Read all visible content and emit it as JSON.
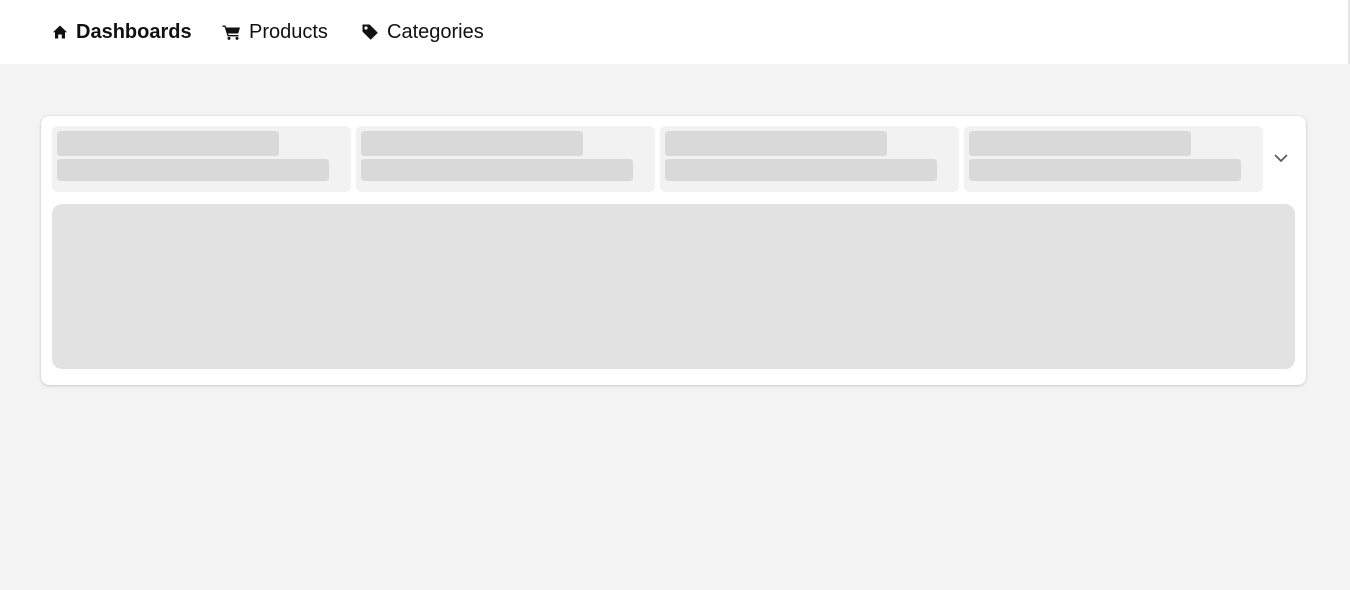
{
  "nav": {
    "items": [
      {
        "label": "Dashboards",
        "icon": "home-icon",
        "active": true
      },
      {
        "label": "Products",
        "icon": "cart-icon",
        "active": false
      },
      {
        "label": "Categories",
        "icon": "tag-icon",
        "active": false
      }
    ]
  },
  "dashboard": {
    "state": "loading",
    "kpi_placeholders": 4,
    "expand_icon": "chevron-down-icon"
  },
  "colors": {
    "page_bg": "#f3f3f3",
    "skeleton": "#d9d9d9",
    "skeleton_block": "#e2e2e2"
  }
}
